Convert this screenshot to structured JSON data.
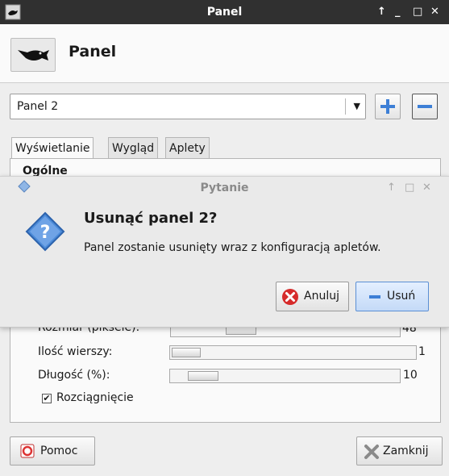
{
  "window": {
    "title": "Panel",
    "controls": {
      "up": "↑",
      "minimize": "_",
      "maximize": "□",
      "close": "✕"
    }
  },
  "header": {
    "title": "Panel"
  },
  "panel_select": {
    "selected": "Panel 2"
  },
  "tabs": [
    {
      "label": "Wyświetlanie",
      "active": true
    },
    {
      "label": "Wygląd",
      "active": false
    },
    {
      "label": "Aplety",
      "active": false
    }
  ],
  "section": {
    "title": "Ogólne"
  },
  "settings": {
    "size": {
      "label": "Rozmiar (piksele):",
      "value": "48"
    },
    "rows": {
      "label": "Ilość wierszy:",
      "value": "1"
    },
    "length": {
      "label": "Długość (%):",
      "value": "10"
    },
    "stretch": {
      "label": "Rozciągnięcie",
      "checked": true
    }
  },
  "buttons": {
    "help": "Pomoc",
    "close": "Zamknij"
  },
  "dialog": {
    "title": "Pytanie",
    "heading": "Usunąć panel 2?",
    "message": "Panel zostanie usunięty wraz z konfiguracją apletów.",
    "cancel": "Anuluj",
    "remove": "Usuń",
    "controls": {
      "up": "↑",
      "maximize": "□",
      "close": "✕"
    }
  },
  "colors": {
    "titlebar": "#303030",
    "accent": "#3d7fd6",
    "cancel_icon": "#d62b2b"
  },
  "icons": [
    "app-icon",
    "mouse-panel-icon",
    "dropdown-arrow-icon",
    "plus-icon",
    "minus-icon",
    "question-icon",
    "cancel-icon",
    "remove-icon",
    "help-icon",
    "close-x-icon"
  ]
}
